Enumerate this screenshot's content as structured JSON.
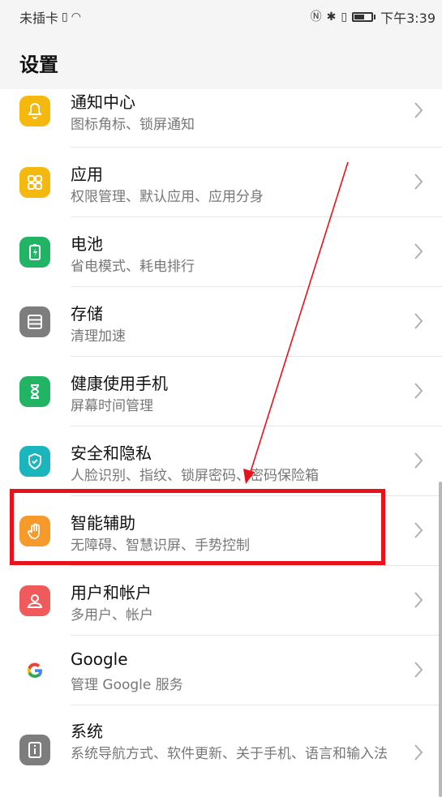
{
  "status_bar": {
    "carrier": "未插卡",
    "time": "下午3:39"
  },
  "header": {
    "title": "设置"
  },
  "settings": [
    {
      "title": "通知中心",
      "subtitle": "图标角标、锁屏通知",
      "icon": "bell-icon",
      "color": "#f5b80e"
    },
    {
      "title": "应用",
      "subtitle": "权限管理、默认应用、应用分身",
      "icon": "apps-grid-icon",
      "color": "#f5b80e"
    },
    {
      "title": "电池",
      "subtitle": "省电模式、耗电排行",
      "icon": "battery-icon",
      "color": "#20b464"
    },
    {
      "title": "存储",
      "subtitle": "清理加速",
      "icon": "storage-icon",
      "color": "#7d7d7d"
    },
    {
      "title": "健康使用手机",
      "subtitle": "屏幕时间管理",
      "icon": "hourglass-icon",
      "color": "#20b464"
    },
    {
      "title": "安全和隐私",
      "subtitle": "人脸识别、指纹、锁屏密码、密码保险箱",
      "icon": "shield-icon",
      "color": "#1bb5bd"
    },
    {
      "title": "智能辅助",
      "subtitle": "无障碍、智慧识屏、手势控制",
      "icon": "hand-icon",
      "color": "#f79a2c"
    },
    {
      "title": "用户和帐户",
      "subtitle": "多用户、帐户",
      "icon": "user-icon",
      "color": "#ef5a5a"
    },
    {
      "title": "Google",
      "subtitle": "管理 Google 服务",
      "icon": "google-icon",
      "color": "#ffffff"
    },
    {
      "title": "系统",
      "subtitle": "系统导航方式、软件更新、关于手机、语言和输入法",
      "icon": "info-icon",
      "color": "#7d7d7d"
    }
  ],
  "annotation": {
    "highlight_color": "#e8121b",
    "highlighted_item": "智能辅助"
  }
}
